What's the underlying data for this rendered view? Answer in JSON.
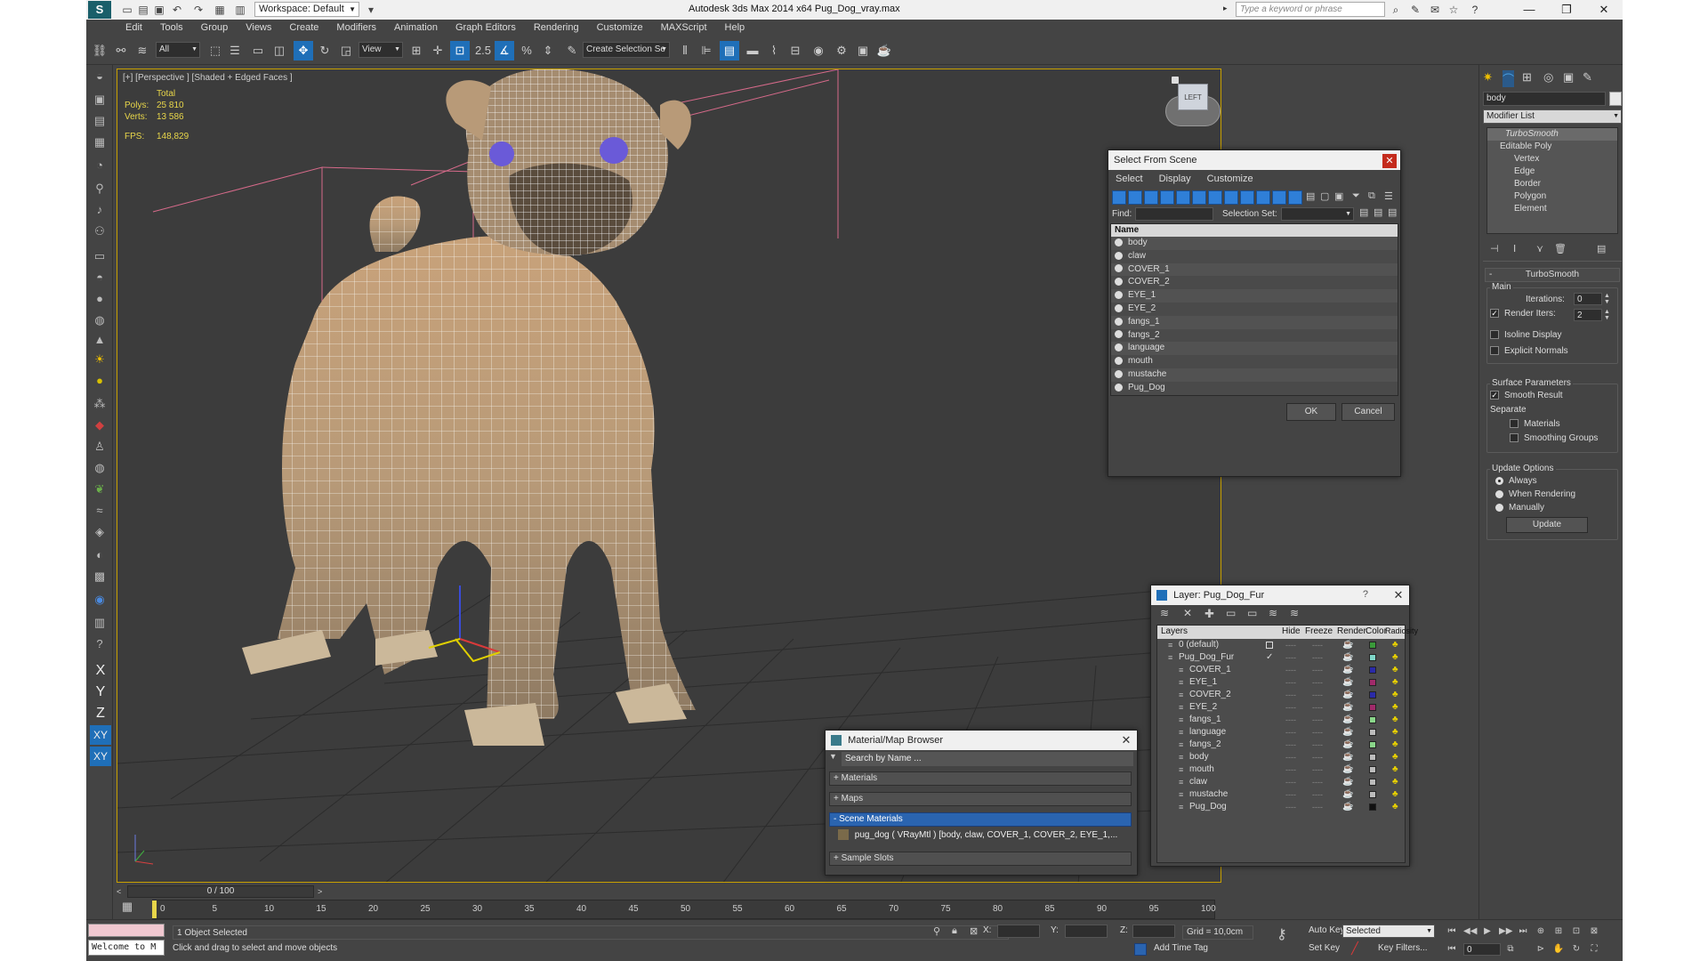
{
  "title_bar": {
    "app_logo": "3ds-max-logo",
    "workspace": "Workspace: Default",
    "window_title": "Autodesk 3ds Max  2014 x64     Pug_Dog_vray.max",
    "search_placeholder": "Type a keyword or phrase"
  },
  "menu": [
    "Edit",
    "Tools",
    "Group",
    "Views",
    "Create",
    "Modifiers",
    "Animation",
    "Graph Editors",
    "Rendering",
    "Customize",
    "MAXScript",
    "Help"
  ],
  "toolbar": {
    "selection_filter": "All",
    "ref_coord": "View",
    "snap_label": "2.5",
    "create_selection_set": "Create Selection Se"
  },
  "left_axes": [
    "X",
    "Y",
    "Z",
    "XY",
    "XY"
  ],
  "viewport": {
    "label": "[+] [Perspective ] [Shaded + Edged Faces ]",
    "stats": {
      "total_label": "Total",
      "polys_label": "Polys:",
      "polys_value": "25 810",
      "verts_label": "Verts:",
      "verts_value": "13 586",
      "fps_label": "FPS:",
      "fps_value": "148,829"
    },
    "viewcube_label": "LEFT"
  },
  "select_from_scene": {
    "title": "Select From Scene",
    "tabs": [
      "Select",
      "Display",
      "Customize"
    ],
    "find_label": "Find:",
    "selection_set_label": "Selection Set:",
    "column_name": "Name",
    "objects": [
      "body",
      "claw",
      "COVER_1",
      "COVER_2",
      "EYE_1",
      "EYE_2",
      "fangs_1",
      "fangs_2",
      "language",
      "mouth",
      "mustache",
      "Pug_Dog"
    ],
    "ok": "OK",
    "cancel": "Cancel"
  },
  "layer_dialog": {
    "title": "Layer: Pug_Dog_Fur",
    "help": "?",
    "columns": [
      "Layers",
      "Hide",
      "Freeze",
      "Render",
      "Color",
      "Radiosity"
    ],
    "layers": [
      {
        "name": "0 (default)",
        "color": "#3a9a3a",
        "level": 0
      },
      {
        "name": "Pug_Dog_Fur",
        "color": "#7fd6c8",
        "level": 0
      },
      {
        "name": "COVER_1",
        "color": "#2a2aa8",
        "level": 1
      },
      {
        "name": "EYE_1",
        "color": "#a02a6a",
        "level": 1
      },
      {
        "name": "COVER_2",
        "color": "#2a2aa8",
        "level": 1
      },
      {
        "name": "EYE_2",
        "color": "#a02a6a",
        "level": 1
      },
      {
        "name": "fangs_1",
        "color": "#8ad68a",
        "level": 1
      },
      {
        "name": "language",
        "color": "#bcbcbc",
        "level": 1
      },
      {
        "name": "fangs_2",
        "color": "#8ad68a",
        "level": 1
      },
      {
        "name": "body",
        "color": "#bcbcbc",
        "level": 1
      },
      {
        "name": "mouth",
        "color": "#bcbcbc",
        "level": 1
      },
      {
        "name": "claw",
        "color": "#bcbcbc",
        "level": 1
      },
      {
        "name": "mustache",
        "color": "#bcbcbc",
        "level": 1
      },
      {
        "name": "Pug_Dog",
        "color": "#111111",
        "level": 1
      }
    ]
  },
  "material_browser": {
    "title": "Material/Map Browser",
    "search_placeholder": "Search by Name ...",
    "sections": [
      "+ Materials",
      "+ Maps",
      "- Scene Materials"
    ],
    "scene_material": "pug_dog  ( VRayMtl )  [body, claw, COVER_1, COVER_2, EYE_1,...",
    "sample_slots": "+ Sample Slots"
  },
  "command_panel": {
    "object_name": "body",
    "modifier_list": "Modifier List",
    "stack": [
      "TurboSmooth",
      "Editable Poly",
      "Vertex",
      "Edge",
      "Border",
      "Polygon",
      "Element"
    ],
    "rollout_title": "TurboSmooth",
    "main_label": "Main",
    "iterations_label": "Iterations:",
    "iterations_value": "0",
    "render_iters_label": "Render Iters:",
    "render_iters_value": "2",
    "isoline_display": "Isoline Display",
    "explicit_normals": "Explicit Normals",
    "surface_parameters": "Surface Parameters",
    "smooth_result": "Smooth Result",
    "separate": "Separate",
    "materials": "Materials",
    "smoothing_groups": "Smoothing Groups",
    "update_options": "Update Options",
    "always": "Always",
    "when_rendering": "When Rendering",
    "manually": "Manually",
    "update_button": "Update"
  },
  "timeline": {
    "frame_display": "0 / 100",
    "ticks": [
      "0",
      "5",
      "10",
      "15",
      "20",
      "25",
      "30",
      "35",
      "40",
      "45",
      "50",
      "55",
      "60",
      "65",
      "70",
      "75",
      "80",
      "85",
      "90",
      "95",
      "100"
    ]
  },
  "status": {
    "maxscript_listener": "Welcome to M",
    "selected": "1 Object Selected",
    "prompt": "Click and drag to select and move objects",
    "x_label": "X:",
    "y_label": "Y:",
    "z_label": "Z:",
    "grid": "Grid = 10,0cm",
    "add_time_tag": "Add Time Tag",
    "auto_key": "Auto Key",
    "set_key": "Set Key",
    "key_mode": "Selected",
    "key_filters": "Key Filters...",
    "current_frame": "0"
  }
}
